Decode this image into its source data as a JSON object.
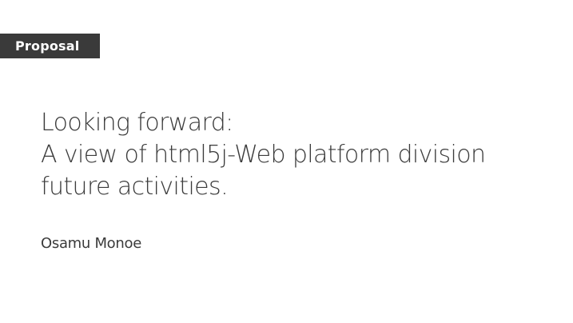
{
  "tag": {
    "label": "Proposal"
  },
  "title": {
    "lines": [
      "Looking forward:",
      "A view of html5j-Web platform division",
      "future activities."
    ]
  },
  "author": {
    "name": "Osamu Monoe"
  },
  "colors": {
    "background": "#ffffff",
    "tag_background": "#3a3a3a",
    "tag_text": "#ffffff",
    "text": "#3b3b3b"
  }
}
